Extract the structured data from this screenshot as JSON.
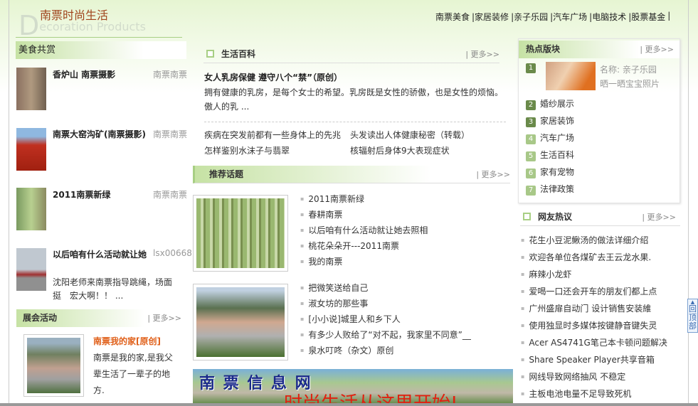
{
  "header": {
    "logo_cn": "南票时尚生活",
    "logo_en_initial": "D",
    "logo_en_rest": "ecoration Products",
    "nav": [
      "南票美食",
      "|家居装修",
      "|亲子乐园",
      "|汽车广场",
      "|电脑技术",
      "|股票基金",
      "|"
    ]
  },
  "food": {
    "title": "美食共赏",
    "items": [
      {
        "title": "香炉山 南票摄影",
        "author": "南票南票"
      },
      {
        "title": "南票大窑沟矿(南票摄影)",
        "author": "南票南票"
      },
      {
        "title": "2011南票新绿",
        "author": "南票南票"
      },
      {
        "title": "以后咱有什么活动就让她",
        "author": "lsx00668",
        "desc": "沈阳老师来南票指导跳绳，场面挺　宏大啊！！ ..."
      }
    ]
  },
  "expo": {
    "title": "展会活动",
    "more": "| 更多>>",
    "item_title": "南票我的家[原创]",
    "item_desc": "南票是我的家,是我父辈生活了一辈子的地方."
  },
  "life": {
    "title": "生活百科",
    "more": "| 更多>>",
    "headline": "女人乳房保健 遵守八个“禁”（原创）",
    "summary": "拥有健康的乳房，是每个女士的希望。乳房既是女性的骄傲，也是女性的烦恼。傲人的乳 ...",
    "links": [
      "疾病在突发前都有一些身体上的先兆",
      "头发读出人体健康秘密（转载）",
      "怎样鉴别水沫子与翡翠",
      "核辐射后身体9大表现症状"
    ]
  },
  "topics": {
    "title": "推荐话题",
    "more": "| 更多>>",
    "group1": [
      "2011南票新绿",
      "春耕南票",
      "以后咱有什么活动就让她去照相",
      "桃花朵朵开---2011南票",
      "我的南票"
    ],
    "group2": [
      "把微笑送给自己",
      "淑女坊的那些事",
      "[小小说]城里人和乡下人",
      "有多少人败给了“对不起，我家里不同意”__",
      "泉水叮咚（杂文）原创"
    ]
  },
  "banner": {
    "title": "南 票 信 息 网",
    "slogan": "时尚生活从这里开始!"
  },
  "hot": {
    "title": "热点版块",
    "more": "| 更多>>",
    "featured": {
      "num": "1",
      "name": "名称: 亲子乐园",
      "desc": "晒一晒宝宝照片"
    },
    "items": [
      {
        "num": "2",
        "label": "婚纱展示"
      },
      {
        "num": "3",
        "label": "家居装饰"
      },
      {
        "num": "4",
        "label": "汽车广场"
      },
      {
        "num": "5",
        "label": "生活百科"
      },
      {
        "num": "6",
        "label": "家有宠物"
      },
      {
        "num": "7",
        "label": "法律政策"
      }
    ]
  },
  "forum": {
    "title": "网友热议",
    "more": "| 更多>>",
    "items": [
      "花生小豆泥鳅汤的做法详细介绍",
      "欢迎各单位各煤矿去王云龙水果.",
      "麻辣小龙虾",
      "爱喝一口还会开车的朋友们都上点",
      "广州盛扉自动门 设计销售安装維",
      "使用独显时多媒体按键静音键失灵",
      "Acer AS4741G笔己本卡顿问题解决",
      "Share Speaker Player共享音箱",
      "网线导致网络抽风 不稳定",
      "主板电池电量不足导致死机"
    ]
  },
  "back_top": "回顶部",
  "colors": {
    "accent_green": "#a8cf84",
    "title_brown": "#a0441c",
    "highlight_orange": "#e0601a"
  }
}
